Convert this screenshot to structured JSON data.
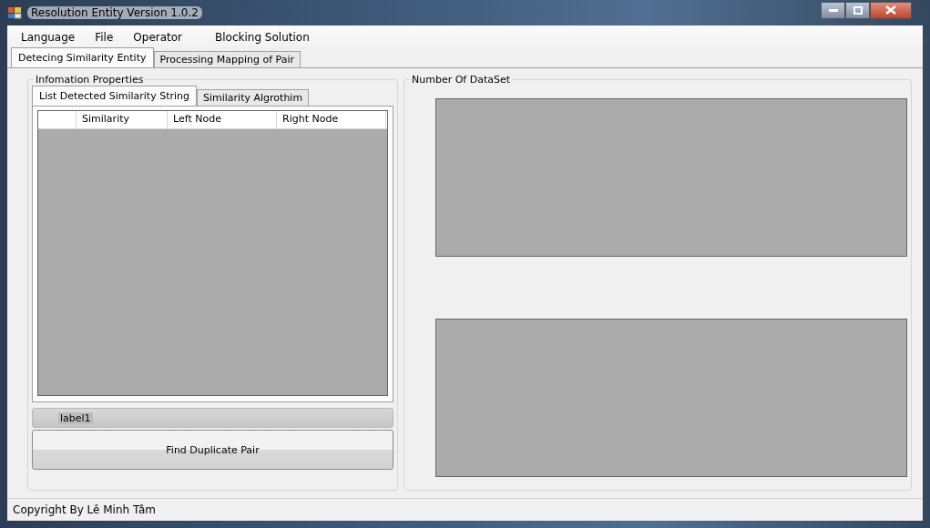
{
  "window": {
    "title": "Resolution Entity Version 1.0.2"
  },
  "menu": [
    "Language",
    "File",
    "Operator",
    "Blocking Solution"
  ],
  "tabs": [
    {
      "label": "Detecing Similarity Entity",
      "selected": true
    },
    {
      "label": "Processing Mapping of Pair",
      "selected": false
    }
  ],
  "info_group": {
    "title": "Infomation Properties",
    "tabs": [
      {
        "label": "List Detected Similarity String",
        "selected": true
      },
      {
        "label": "Similarity Algrothim",
        "selected": false
      }
    ],
    "table": {
      "columns": [
        "Similarity",
        "Left Node",
        "Right Node"
      ]
    },
    "label": "label1",
    "button": "Find Duplicate Pair"
  },
  "dataset_group": {
    "title": "Number Of DataSet",
    "panels": [
      {
        "kind": "empty"
      },
      {
        "kind": "empty"
      }
    ]
  },
  "status_bar": "Copyright By Lê Minh Tâm"
}
